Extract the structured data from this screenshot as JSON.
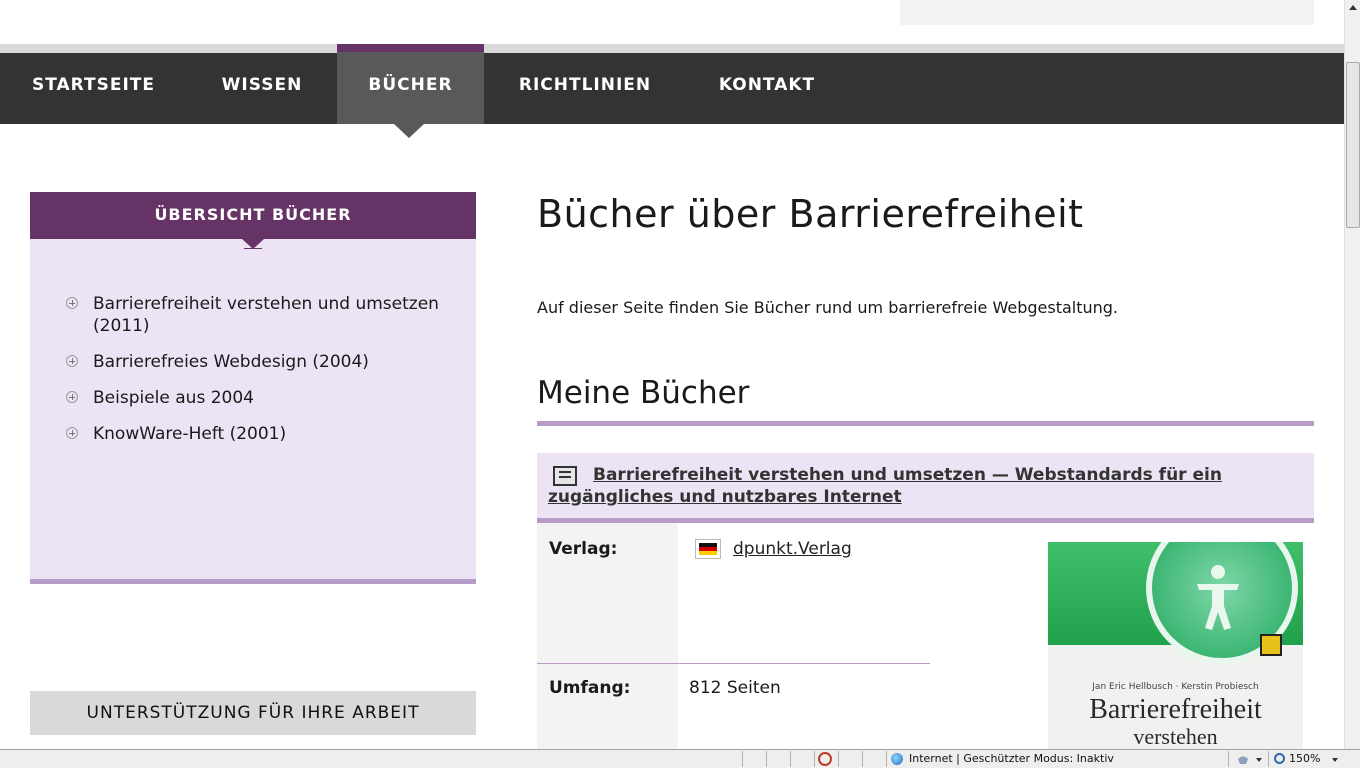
{
  "nav": {
    "items": [
      {
        "label": "STARTSEITE"
      },
      {
        "label": "WISSEN"
      },
      {
        "label": "BÜCHER"
      },
      {
        "label": "RICHTLINIEN"
      },
      {
        "label": "KONTAKT"
      }
    ],
    "active": "BÜCHER"
  },
  "sidebar": {
    "heading": "ÜBERSICHT BÜCHER",
    "items": [
      {
        "label": "Barrierefreiheit verstehen und umsetzen (2011)"
      },
      {
        "label": "Barrierefreies Webdesign (2004)"
      },
      {
        "label": "Beispiele aus 2004"
      },
      {
        "label": "KnowWare-Heft (2001)"
      }
    ],
    "support_label": "UNTERSTÜTZUNG FÜR IHRE ARBEIT"
  },
  "main": {
    "title": "Bücher über Barrierefreiheit",
    "intro": "Auf dieser Seite finden Sie Bücher rund um barrierefreie Webgestaltung.",
    "section_title": "Meine Bücher",
    "book": {
      "title": "Barrierefreiheit verstehen und umsetzen — Webstandards für ein zugängliches und nutzbares Internet",
      "verlag_label": "Verlag:",
      "verlag_value": "dpunkt.Verlag",
      "umfang_label": "Umfang:",
      "umfang_value": "812 Seiten",
      "cover": {
        "authors": "Jan Eric Hellbusch · Kerstin Probiesch",
        "title": "Barrierefreiheit",
        "subtitle": "verstehen"
      }
    }
  },
  "statusbar": {
    "zone": "Internet | Geschützter Modus: Inaktiv",
    "zoom": "150%"
  },
  "colors": {
    "nav_bg": "#333333",
    "nav_active": "#595959",
    "accent_purple": "#663366",
    "light_purple": "#ece3f4",
    "line_purple": "#b79cc9"
  }
}
